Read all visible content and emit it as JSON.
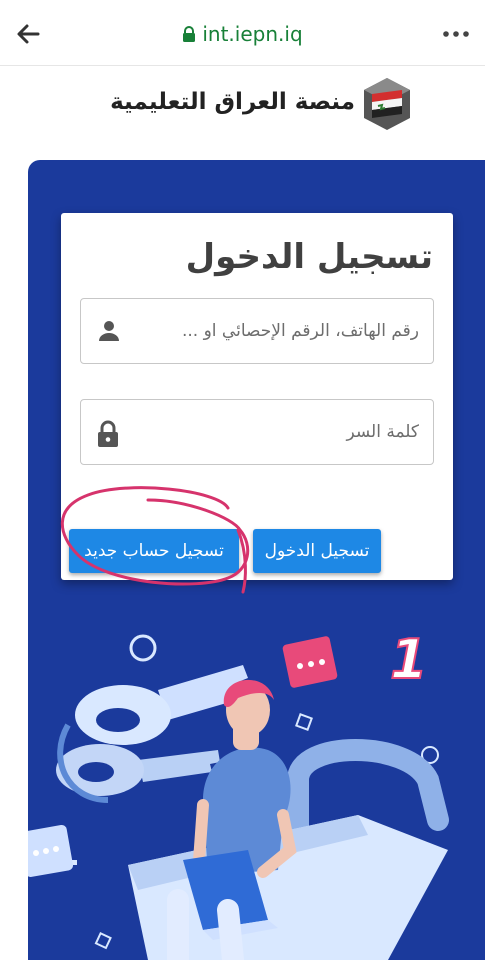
{
  "browser": {
    "url": "int.iepn.iq",
    "colors": {
      "url_green": "#188038"
    }
  },
  "brand": {
    "title": "منصة العراق التعليمية"
  },
  "login": {
    "title": "تسجيل الدخول",
    "username_placeholder": "رقم الهاتف، الرقم الإحصائي او ...",
    "password_placeholder": "كلمة السر",
    "login_button": "تسجيل الدخول",
    "register_button": "تسجيل حساب جديد"
  },
  "colors": {
    "panel_blue": "#1b3a9c",
    "button_blue": "#1e88e5",
    "annotation_pink": "#d6336c"
  },
  "illustration": {
    "badge_text": "1"
  }
}
